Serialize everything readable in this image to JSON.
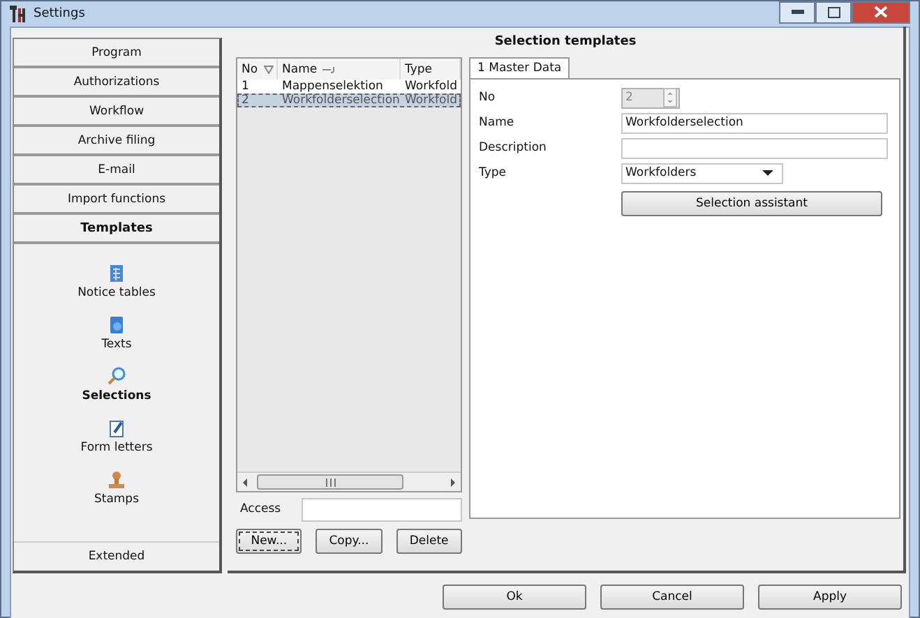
{
  "window": {
    "title": "Settings"
  },
  "nav": {
    "sections": [
      {
        "label": "Program",
        "expanded": false
      },
      {
        "label": "Authorizations",
        "expanded": false
      },
      {
        "label": "Workflow",
        "expanded": false
      },
      {
        "label": "Archive filing",
        "expanded": false
      },
      {
        "label": "E-mail",
        "expanded": false
      },
      {
        "label": "Import functions",
        "expanded": false
      },
      {
        "label": "Templates",
        "expanded": true,
        "items": [
          {
            "label": "Notice tables",
            "kind": "table",
            "selected": false
          },
          {
            "label": "Texts",
            "kind": "book",
            "selected": false
          },
          {
            "label": "Selections",
            "kind": "magnifier",
            "selected": true
          },
          {
            "label": "Form letters",
            "kind": "note",
            "selected": false
          },
          {
            "label": "Stamps",
            "kind": "stamp",
            "selected": false
          }
        ]
      },
      {
        "label": "Extended",
        "expanded": false
      }
    ]
  },
  "panel": {
    "title": "Selection templates"
  },
  "list": {
    "columns": [
      {
        "label": "No",
        "kind": "filter"
      },
      {
        "label": "Name",
        "kind": "pin"
      },
      {
        "label": "Type",
        "kind": "plain"
      }
    ],
    "rows": [
      {
        "cells": [
          "1",
          "Mappenselektion",
          "Workfold"
        ],
        "selected": false
      },
      {
        "cells": [
          "2",
          "Workfolderselection",
          "Workfold"
        ],
        "selected": true
      }
    ]
  },
  "access": {
    "label": "Access"
  },
  "list_buttons": [
    {
      "label": "New...",
      "focused": true
    },
    {
      "label": "Copy...",
      "focused": false
    },
    {
      "label": "Delete",
      "focused": false
    }
  ],
  "tabs": [
    {
      "label": "1 Master Data",
      "selected": true
    }
  ],
  "fields": [
    {
      "label": "No",
      "kind": "spinner",
      "value": "2",
      "disabled": true
    },
    {
      "label": "Name",
      "kind": "text",
      "value": "Workfolderselection",
      "disabled": false
    },
    {
      "label": "Description",
      "kind": "text",
      "disabled": false
    },
    {
      "label": "Type",
      "kind": "dropdown",
      "value": "Workfolders",
      "disabled": false
    }
  ],
  "assistant_button": {
    "label": "Selection assistant"
  },
  "buttons": [
    {
      "label": "Ok"
    },
    {
      "label": "Cancel"
    },
    {
      "label": "Apply"
    }
  ]
}
